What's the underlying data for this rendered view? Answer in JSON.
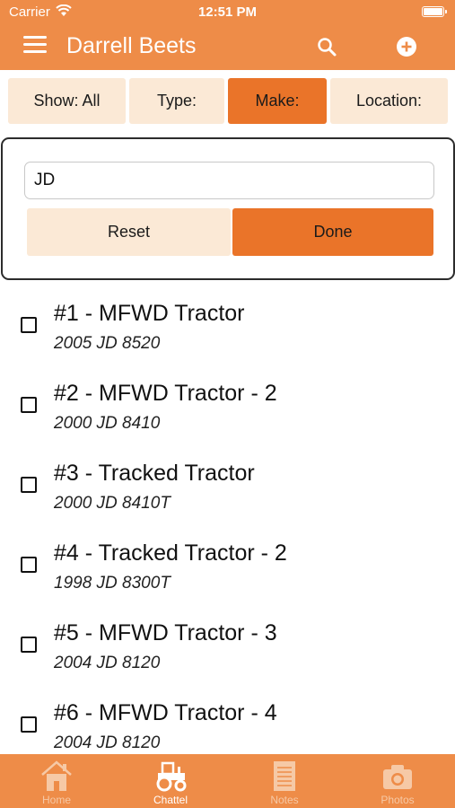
{
  "status_bar": {
    "carrier": "Carrier",
    "time": "12:51 PM"
  },
  "header": {
    "title": "Darrell Beets"
  },
  "filters": [
    {
      "label": "Show: All",
      "active": false
    },
    {
      "label": "Type:",
      "active": false
    },
    {
      "label": "Make:",
      "active": true
    },
    {
      "label": "Location:",
      "active": false
    }
  ],
  "make_popover": {
    "input_value": "JD",
    "reset_label": "Reset",
    "done_label": "Done"
  },
  "items": [
    {
      "title": "#1 -  MFWD Tractor",
      "subtitle": "2005  JD  8520"
    },
    {
      "title": "#2 -  MFWD Tractor - 2",
      "subtitle": "2000  JD  8410"
    },
    {
      "title": "#3 -  Tracked Tractor",
      "subtitle": "2000  JD  8410T"
    },
    {
      "title": "#4 -  Tracked Tractor - 2",
      "subtitle": "1998  JD  8300T"
    },
    {
      "title": "#5 -  MFWD Tractor - 3",
      "subtitle": "2004  JD  8120"
    },
    {
      "title": "#6 -  MFWD Tractor - 4",
      "subtitle": "2004  JD  8120"
    }
  ],
  "tabs": [
    {
      "label": "Home",
      "icon": "home-icon",
      "active": false
    },
    {
      "label": "Chattel",
      "icon": "tractor-icon",
      "active": true
    },
    {
      "label": "Notes",
      "icon": "notes-icon",
      "active": false
    },
    {
      "label": "Photos",
      "icon": "camera-icon",
      "active": false
    }
  ],
  "colors": {
    "accent": "#ee8c48",
    "active_button": "#ea7429",
    "button_bg": "#fbe9d6"
  }
}
